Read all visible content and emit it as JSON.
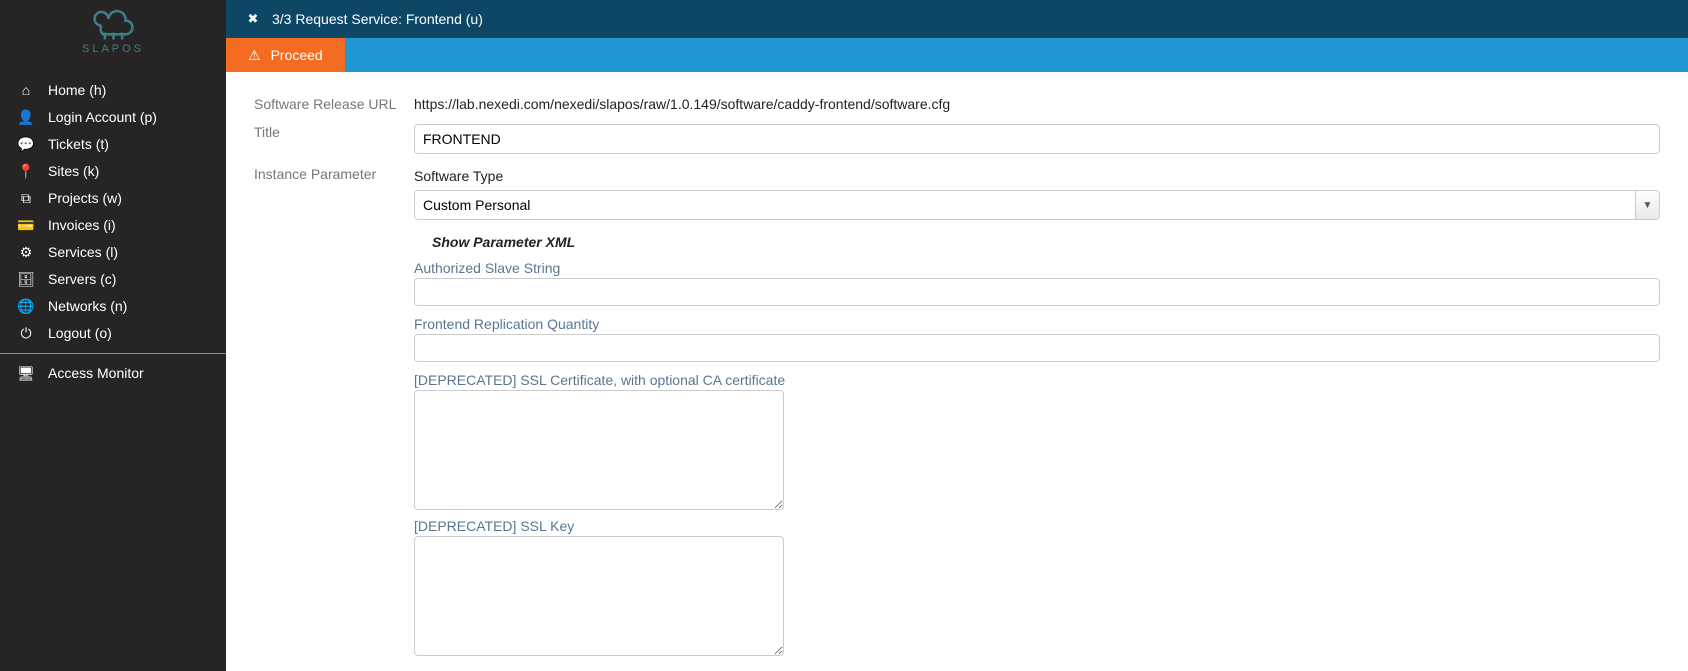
{
  "brand": {
    "name": "SLAPOS"
  },
  "sidebar": {
    "items": [
      {
        "icon": "home-icon",
        "label": "Home (h)"
      },
      {
        "icon": "user-icon",
        "label": "Login Account (p)"
      },
      {
        "icon": "chat-icon",
        "label": "Tickets (t)"
      },
      {
        "icon": "pin-icon",
        "label": "Sites (k)"
      },
      {
        "icon": "cubes-icon",
        "label": "Projects (w)"
      },
      {
        "icon": "card-icon",
        "label": "Invoices (i)"
      },
      {
        "icon": "gears-icon",
        "label": "Services (l)"
      },
      {
        "icon": "db-icon",
        "label": "Servers (c)"
      },
      {
        "icon": "globe-icon",
        "label": "Networks (n)"
      },
      {
        "icon": "power-icon",
        "label": "Logout (o)"
      }
    ],
    "monitor": {
      "icon": "monitor-icon",
      "label": "Access Monitor"
    }
  },
  "header": {
    "title": "3/3 Request Service: Frontend (u)"
  },
  "action": {
    "proceed_label": "Proceed"
  },
  "form": {
    "url_label": "Software Release URL",
    "url_value": "https://lab.nexedi.com/nexedi/slapos/raw/1.0.149/software/caddy-frontend/software.cfg",
    "title_label": "Title",
    "title_value": "FRONTEND",
    "instance_label": "Instance Parameter",
    "software_type_label": "Software Type",
    "software_type_value": "Custom Personal",
    "show_xml_label": "Show Parameter XML",
    "params": [
      {
        "label": "Authorized Slave String",
        "kind": "input",
        "value": ""
      },
      {
        "label": "Frontend Replication Quantity",
        "kind": "input",
        "value": ""
      },
      {
        "label": "[DEPRECATED] SSL Certificate, with optional CA certificate",
        "kind": "textarea",
        "value": ""
      },
      {
        "label": "[DEPRECATED] SSL Key",
        "kind": "textarea",
        "value": ""
      }
    ]
  },
  "icons": {
    "home-icon": "⌂",
    "user-icon": "👤",
    "chat-icon": "💬",
    "pin-icon": "📍",
    "cubes-icon": "⧉",
    "card-icon": "💳",
    "gears-icon": "⚙",
    "db-icon": "🗄",
    "globe-icon": "🌐",
    "power-icon": "⏻",
    "monitor-icon": "🖥",
    "close-icon": "✖",
    "warning-icon": "⚠",
    "chevron-down-icon": "▼"
  }
}
